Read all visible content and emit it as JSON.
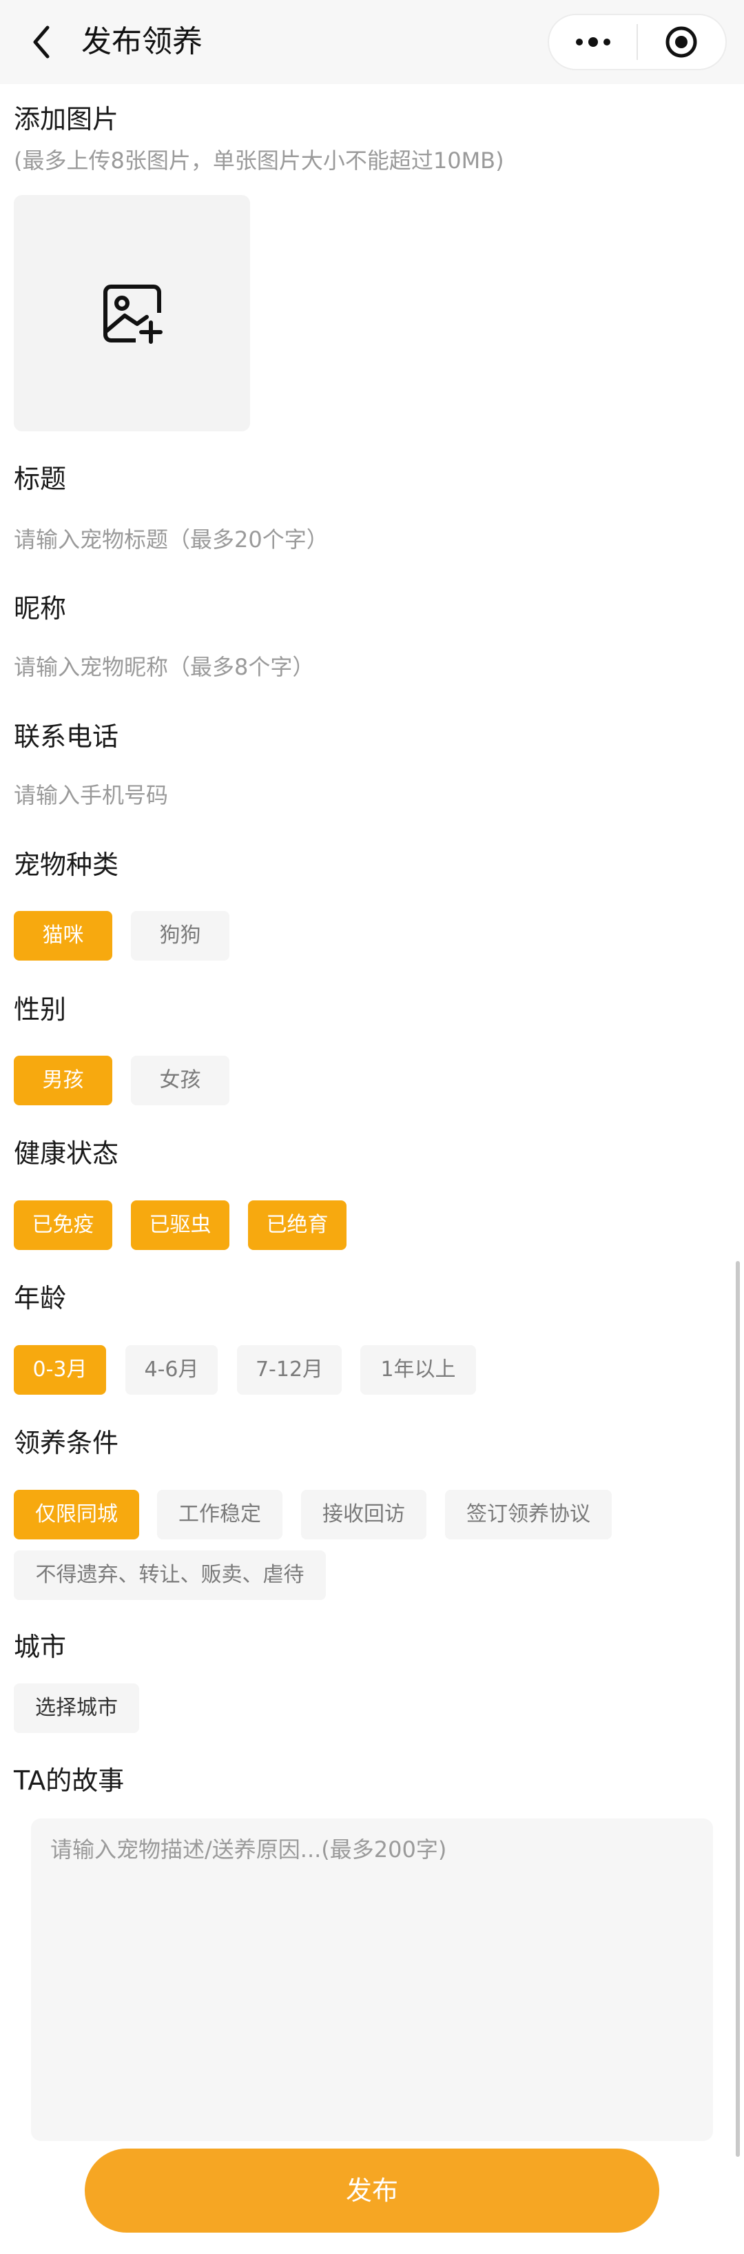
{
  "header": {
    "title": "发布领养",
    "back_icon": "chevron-left-icon",
    "more_icon": "more-dots-icon",
    "close_icon": "record-target-icon"
  },
  "images": {
    "label": "添加图片",
    "hint": "(最多上传8张图片，单张图片大小不能超过10MB)",
    "upload_icon": "image-add-icon"
  },
  "title_field": {
    "label": "标题",
    "placeholder": "请输入宠物标题（最多20个字）"
  },
  "nickname_field": {
    "label": "昵称",
    "placeholder": "请输入宠物昵称（最多8个字）"
  },
  "phone_field": {
    "label": "联系电话",
    "placeholder": "请输入手机号码"
  },
  "species": {
    "label": "宠物种类",
    "options": [
      {
        "label": "猫咪",
        "selected": true
      },
      {
        "label": "狗狗",
        "selected": false
      }
    ]
  },
  "gender": {
    "label": "性别",
    "options": [
      {
        "label": "男孩",
        "selected": true
      },
      {
        "label": "女孩",
        "selected": false
      }
    ]
  },
  "health": {
    "label": "健康状态",
    "options": [
      {
        "label": "已免疫",
        "selected": true
      },
      {
        "label": "已驱虫",
        "selected": true
      },
      {
        "label": "已绝育",
        "selected": true
      }
    ]
  },
  "age": {
    "label": "年龄",
    "options": [
      {
        "label": "0-3月",
        "selected": true
      },
      {
        "label": "4-6月",
        "selected": false
      },
      {
        "label": "7-12月",
        "selected": false
      },
      {
        "label": "1年以上",
        "selected": false
      }
    ]
  },
  "conditions": {
    "label": "领养条件",
    "options": [
      {
        "label": "仅限同城",
        "selected": true
      },
      {
        "label": "工作稳定",
        "selected": false
      },
      {
        "label": "接收回访",
        "selected": false
      },
      {
        "label": "签订领养协议",
        "selected": false
      },
      {
        "label": "不得遗弃、转让、贩卖、虐待",
        "selected": false
      }
    ]
  },
  "city": {
    "label": "城市",
    "button": "选择城市"
  },
  "story": {
    "label": "TA的故事",
    "placeholder": "请输入宠物描述/送养原因...(最多200字)"
  },
  "publish_button": "发布",
  "colors": {
    "accent": "#f7a90f",
    "publish": "#f6a623",
    "chip_bg": "#f5f5f5"
  }
}
